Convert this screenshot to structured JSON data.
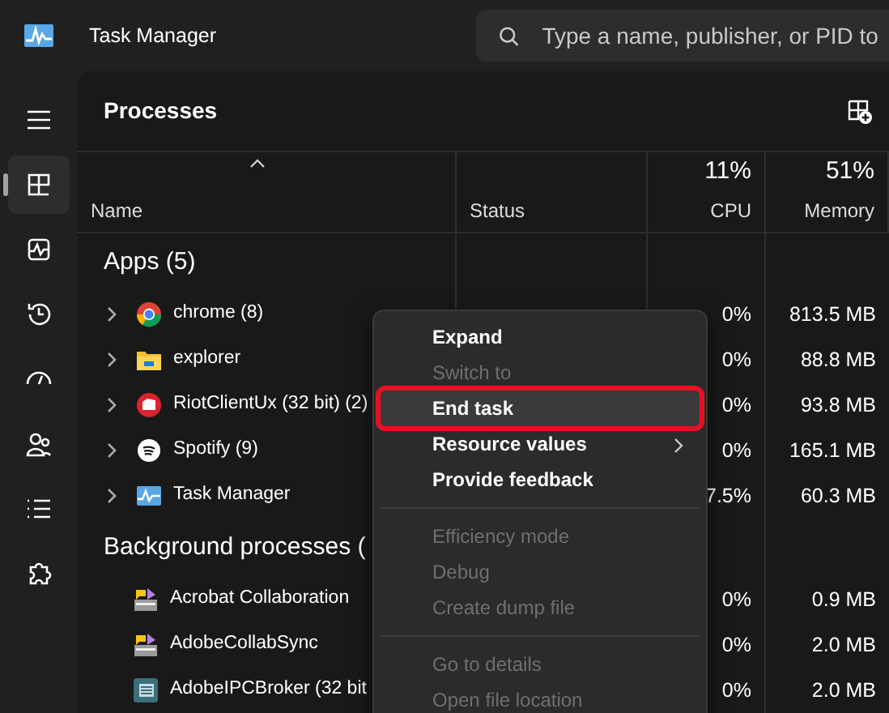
{
  "window": {
    "title": "Task Manager"
  },
  "search": {
    "placeholder": "Type a name, publisher, or PID to"
  },
  "sidebar": {
    "items": [
      {
        "selected": true
      },
      {
        "selected": false
      },
      {
        "selected": false
      },
      {
        "selected": false
      },
      {
        "selected": false
      },
      {
        "selected": false
      },
      {
        "selected": false
      }
    ]
  },
  "page_title": "Processes",
  "table": {
    "columns": [
      {
        "label": "Name"
      },
      {
        "label": "Status"
      },
      {
        "label": "CPU",
        "summary": "11%"
      },
      {
        "label": "Memory",
        "summary": "51%"
      }
    ],
    "sections": [
      {
        "title": "Apps (5)",
        "rows": [
          {
            "name": "chrome (8)",
            "expandable": true,
            "cpu": "0%",
            "memory": "813.5 MB"
          },
          {
            "name": "explorer",
            "expandable": true,
            "cpu": "0%",
            "memory": "88.8 MB"
          },
          {
            "name": "RiotClientUx (32 bit) (2)",
            "expandable": true,
            "cpu": "0%",
            "memory": "93.8 MB"
          },
          {
            "name": "Spotify (9)",
            "expandable": true,
            "cpu": "0%",
            "memory": "165.1 MB"
          },
          {
            "name": "Task Manager",
            "expandable": true,
            "cpu": "7.5%",
            "memory": "60.3 MB"
          }
        ]
      },
      {
        "title": "Background processes (",
        "rows": [
          {
            "name": "Acrobat Collaboration",
            "expandable": false,
            "cpu": "0%",
            "memory": "0.9 MB"
          },
          {
            "name": "AdobeCollabSync",
            "expandable": false,
            "cpu": "0%",
            "memory": "2.0 MB"
          },
          {
            "name": "AdobeIPCBroker (32 bit",
            "expandable": false,
            "cpu": "0%",
            "memory": "2.0 MB"
          }
        ]
      }
    ]
  },
  "context_menu": {
    "groups": [
      [
        {
          "label": "Expand",
          "disabled": false,
          "selected": false,
          "submenu": false
        },
        {
          "label": "Switch to",
          "disabled": true,
          "selected": false,
          "submenu": false
        },
        {
          "label": "End task",
          "disabled": false,
          "selected": true,
          "submenu": false
        },
        {
          "label": "Resource values",
          "disabled": false,
          "selected": false,
          "submenu": true
        },
        {
          "label": "Provide feedback",
          "disabled": false,
          "selected": false,
          "submenu": false
        }
      ],
      [
        {
          "label": "Efficiency mode",
          "disabled": true,
          "selected": false,
          "submenu": false
        },
        {
          "label": "Debug",
          "disabled": true,
          "selected": false,
          "submenu": false
        },
        {
          "label": "Create dump file",
          "disabled": true,
          "selected": false,
          "submenu": false
        }
      ],
      [
        {
          "label": "Go to details",
          "disabled": true,
          "selected": false,
          "submenu": false
        },
        {
          "label": "Open file location",
          "disabled": true,
          "selected": false,
          "submenu": false
        }
      ]
    ]
  }
}
